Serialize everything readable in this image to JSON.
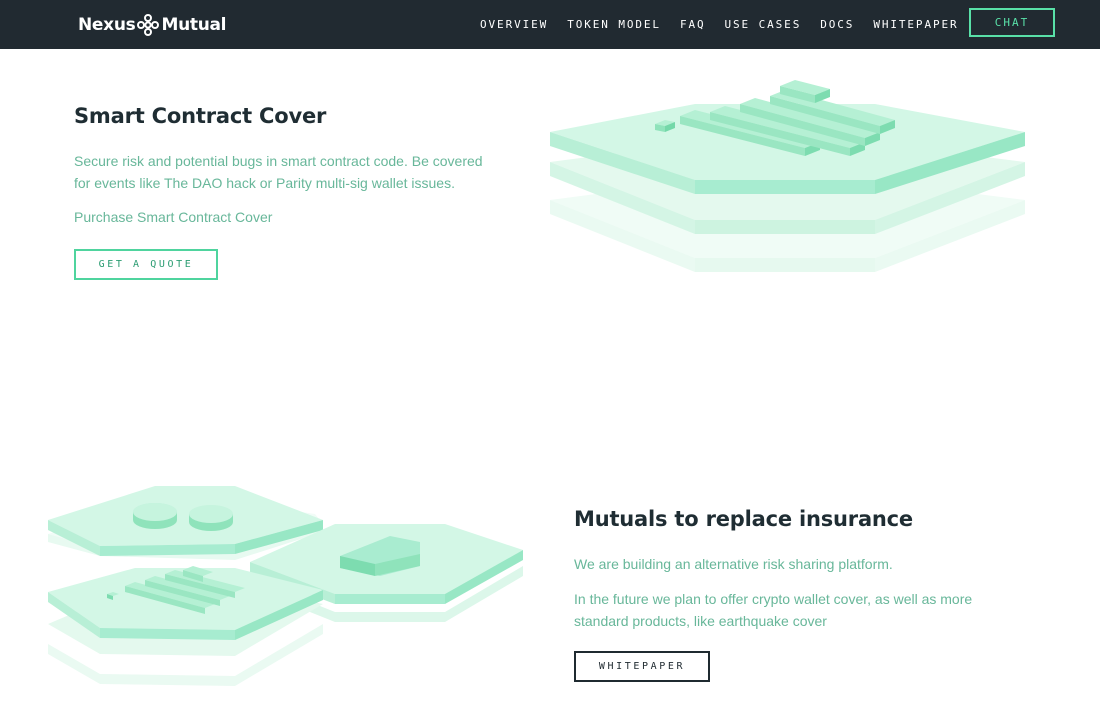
{
  "nav": {
    "brand_left": "Nexus",
    "brand_right": "Mutual",
    "links": [
      "OVERVIEW",
      "TOKEN MODEL",
      "FAQ",
      "USE CASES",
      "DOCS",
      "WHITEPAPER"
    ],
    "cta": "CHAT"
  },
  "smart_contract": {
    "title": "Smart Contract Cover",
    "description": "Secure risk and potential bugs in smart contract code. Be covered for events like The DAO hack or Parity multi-sig wallet issues.",
    "link": "Purchase Smart Contract Cover",
    "button": "GET A QUOTE"
  },
  "mutuals": {
    "title": "Mutuals to replace insurance",
    "paragraph_1": "We are building an alternative risk sharing platform.",
    "paragraph_2": "In the future we plan to offer crypto wallet cover, as well as more standard products, like earthquake cover",
    "button": "WHITEPAPER"
  },
  "colors": {
    "nav_bg": "#212a31",
    "accent": "#59e0a8",
    "text_dark": "#1f2d33",
    "text_green": "#68b79a"
  },
  "icons": {
    "logo": "nexus-mutual-logo-icon",
    "hero_illustration": "stacked-hex-platform-icon",
    "mutuals_illustration": "hex-platform-cluster-icon"
  }
}
